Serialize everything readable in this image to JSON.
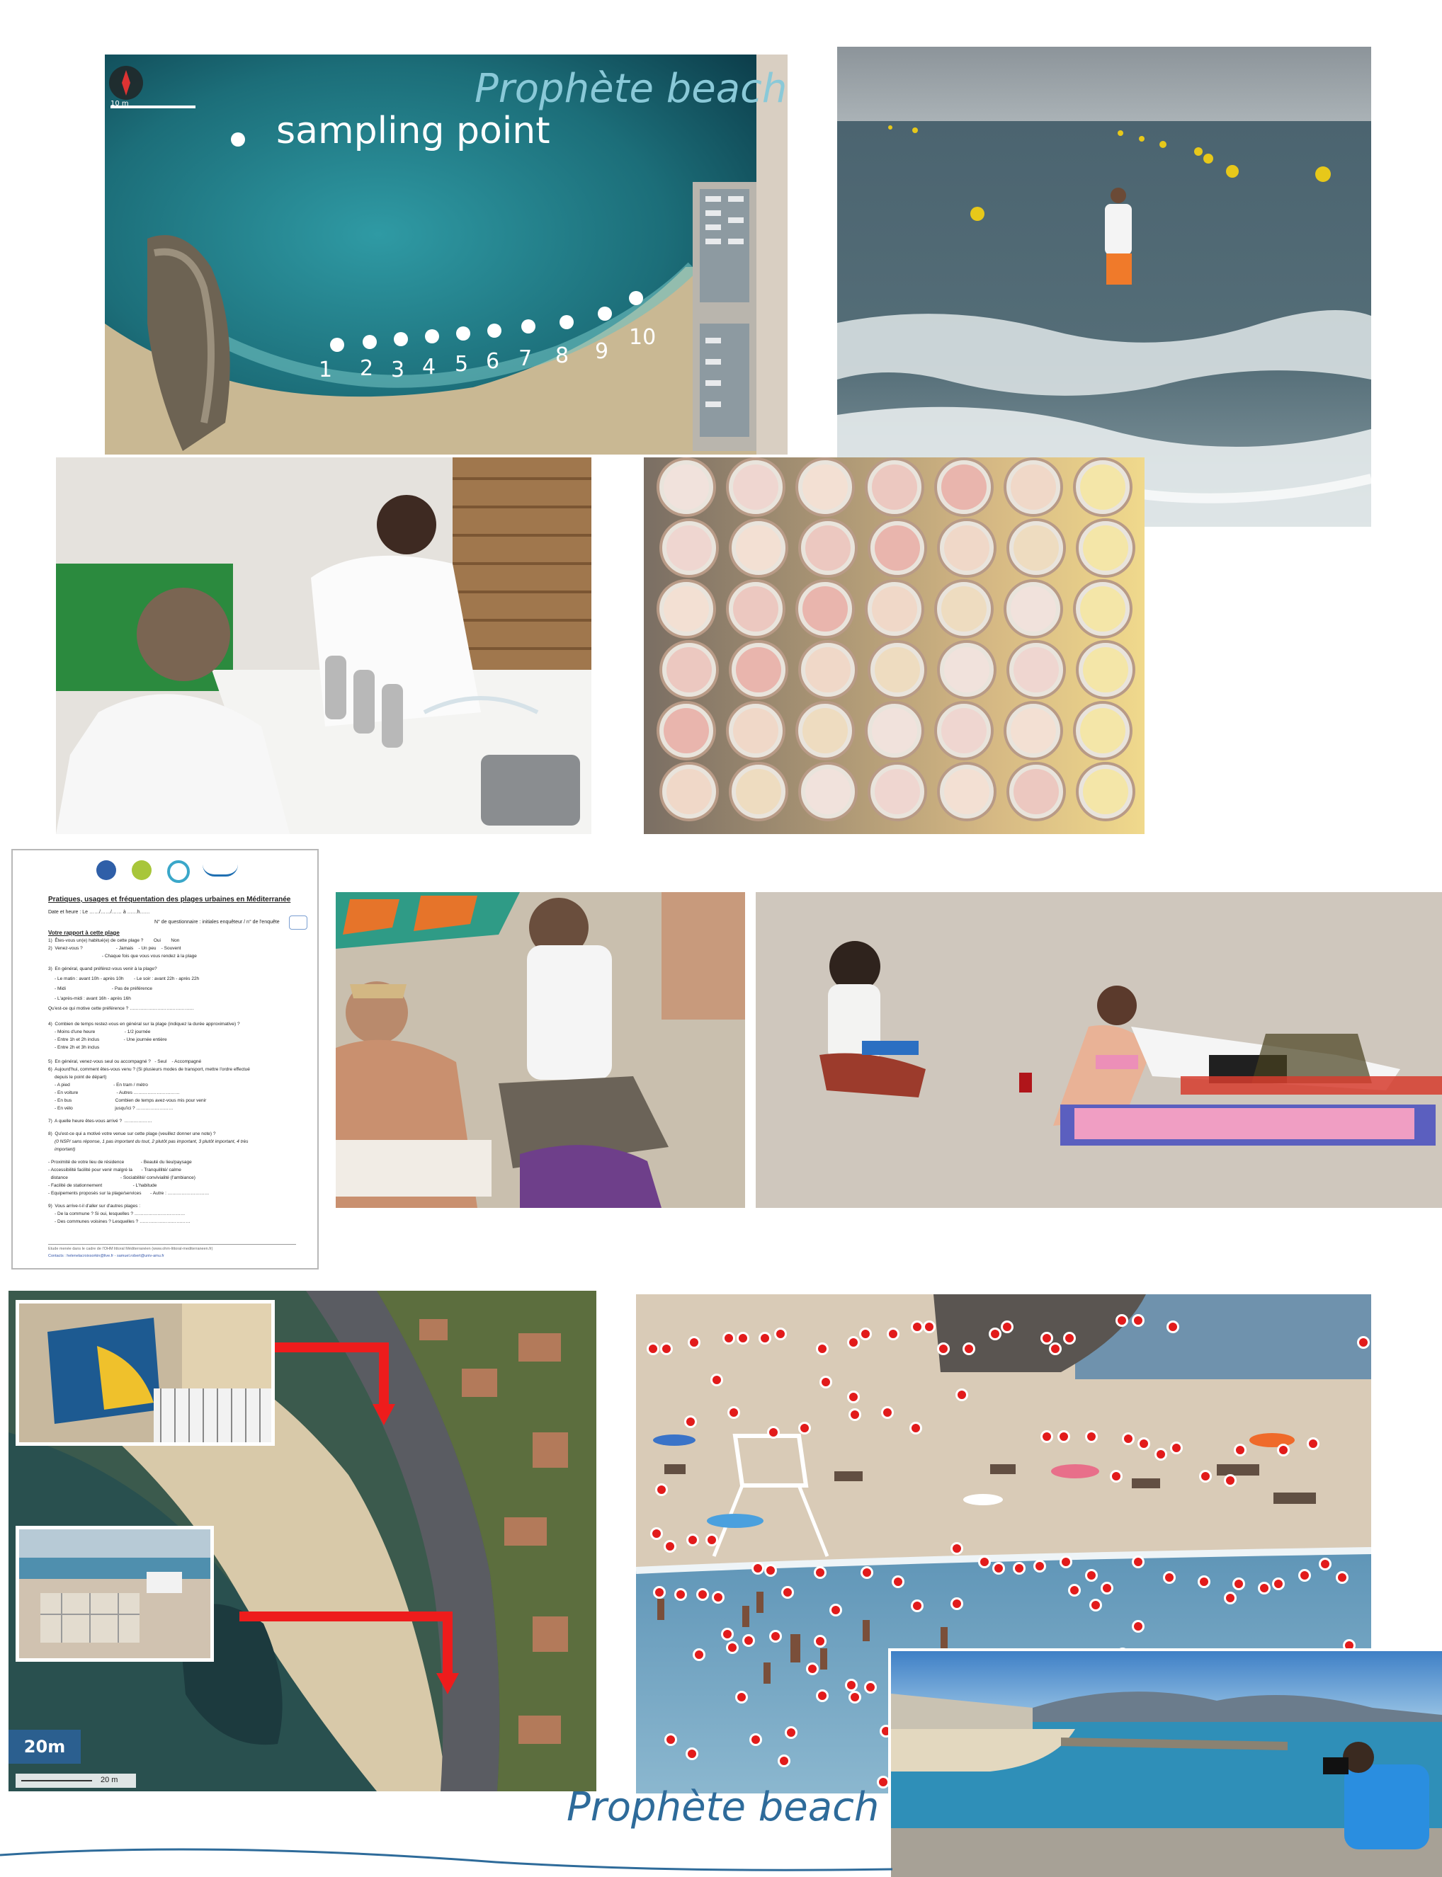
{
  "aerial_map": {
    "title": "Prophète beach",
    "legend_label": "sampling point",
    "scale_label": "10 m",
    "points": [
      "1",
      "2",
      "3",
      "4",
      "5",
      "6",
      "7",
      "8",
      "9",
      "10"
    ]
  },
  "questionnaire": {
    "title": "Pratiques, usages et fréquentation des plages urbaines en Méditerranée",
    "date_line": "Date et heure : Le ……/……/…… à ……h……",
    "number_line": "N° de questionnaire : initiales enquêteur / n° de l'enquête",
    "section_title": "Votre rapport à cette plage",
    "lines": [
      "1)  Êtes-vous un(e) habitué(e) de cette plage ?        Oui        Non",
      "2)  Venez-vous ?                          - Jamais    - Un peu    - Souvent",
      "                                          - Chaque fois que vous vous rendez à la plage",
      "3)  En général, quand préférez-vous venir à la plage?",
      "     - Le matin : avant 10h - après 10h        - Le soir : avant 22h - après 22h",
      "     - Midi                                    - Pas de préférence",
      "     - L'après-midi : avant 16h - après 16h",
      "Qu'est-ce qui motive cette préférence ? ……………………………………",
      "4)  Combien de temps restez-vous en général sur la plage (indiquez la durée approximative) ?",
      "     - Moins d'une heure                       - 1/2 journée",
      "     - Entre 1h et 2h inclus                   - Une journée entière",
      "     - Entre 2h et 3h inclus",
      "5)  En général, venez-vous seul ou accompagné ?   - Seul    - Accompagné",
      "6)  Aujourd'hui, comment êtes-vous venu ? (Si plusieurs modes de transport, mettre l'ordre effectué",
      "     depuis le point de départ)",
      "     - A pied                                  - En tram / métro",
      "     - En voiture                              - Autres …………………………",
      "     - En bus                                  Combien de temps avez-vous mis pour venir",
      "     - En vélo                                 jusqu'ici ? ……………………",
      "7)  A quelle heure êtes-vous arrivé ?  ………………",
      "8)  Qu'est-ce qui a motivé votre venue sur cette plage (veuillez donner une note) ?",
      "     (0 NSP/ sans réponse, 1 pas important du tout, 2 plutôt pas important, 3 plutôt important, 4 très",
      "     important)",
      "- Proximité de votre lieu de résidence             - Beauté du lieu/paysage",
      "- Accessibilité facilité pour venir malgré la       - Tranquillité/ calme",
      "  distance                                         - Sociabilité/ convivialité (l'ambiance)",
      "- Facilité de stationnement                        - L'habitude",
      "- Equipements proposés sur la plage/services       - Autre : ………………………",
      "9)  Vous arrive-t-il d'aller sur d'autres plages :",
      "     - De la commune ? Si oui, lesquelles ? ……………………………",
      "     - Des communes voisines ? Lesquelles ? ……………………………"
    ],
    "footer_line1": "Etude menée dans le cadre de l'OHM littoral Méditerranéen (www.ohm-littoral-mediterraneen.fr)",
    "footer_line2": "Contacts : helenelacroixsorkin@live.fr - samuel.robert@univ-amu.fr"
  },
  "map_panel": {
    "scale_badge": "20m",
    "scale_bar_label": "20 m"
  },
  "bottom_caption": "Prophète beach",
  "colors": {
    "caption_blue": "#2e6b9a",
    "title_teal": "#8ac9d8",
    "arrow_red": "#ee1c1c",
    "people_dot": "#e21b1b",
    "scale_badge": "#2b5f8f"
  }
}
